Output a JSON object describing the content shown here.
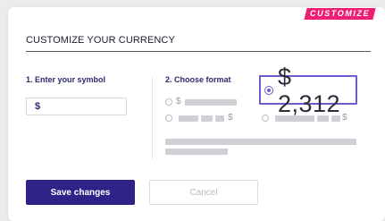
{
  "tag": {
    "label": "CUSTOMIZE"
  },
  "header": {
    "title": "CUSTOMIZE YOUR CURRENCY"
  },
  "symbol_step": {
    "label": "1. Enter your symbol",
    "value": "$"
  },
  "format_step": {
    "label": "2. Choose format",
    "options": [
      {
        "symbol": "$",
        "position": "prefix",
        "selected": false
      },
      {
        "symbol": "$",
        "position": "suffix",
        "selected": false
      },
      {
        "symbol": "$",
        "position": "suffix",
        "selected": false
      }
    ],
    "selected_preview": "$ 2,312"
  },
  "actions": {
    "save_label": "Save changes",
    "cancel_label": "Cancel"
  },
  "colors": {
    "accent_pink": "#ec1f74",
    "primary": "#2d2386",
    "selected_border": "#6d5ccf"
  }
}
